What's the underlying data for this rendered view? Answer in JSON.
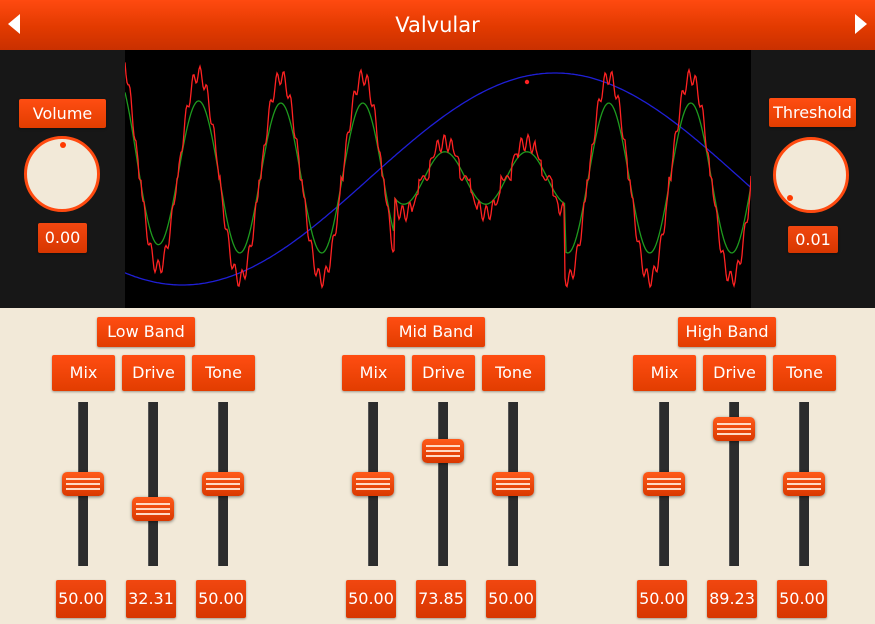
{
  "header": {
    "title": "Valvular"
  },
  "volume": {
    "label": "Volume",
    "value": "0.00"
  },
  "threshold": {
    "label": "Threshold",
    "value": "0.01"
  },
  "bands": [
    {
      "name": "Low Band",
      "controls": [
        {
          "label": "Mix",
          "value": "50.00",
          "level": 0.5
        },
        {
          "label": "Drive",
          "value": "32.31",
          "level": 0.3231
        },
        {
          "label": "Tone",
          "value": "50.00",
          "level": 0.5
        }
      ]
    },
    {
      "name": "Mid Band",
      "controls": [
        {
          "label": "Mix",
          "value": "50.00",
          "level": 0.5
        },
        {
          "label": "Drive",
          "value": "73.85",
          "level": 0.7385
        },
        {
          "label": "Tone",
          "value": "50.00",
          "level": 0.5
        }
      ]
    },
    {
      "name": "High Band",
      "controls": [
        {
          "label": "Mix",
          "value": "50.00",
          "level": 0.5
        },
        {
          "label": "Drive",
          "value": "89.23",
          "level": 0.8923
        },
        {
          "label": "Tone",
          "value": "50.00",
          "level": 0.5
        }
      ]
    }
  ],
  "colors": {
    "accent": "#ff4a10",
    "background": "#f2e9d8",
    "panel": "#171717",
    "trace_input": "#1f1fd6",
    "trace_filtered": "#1e9a1e",
    "trace_output": "#ff2222"
  }
}
